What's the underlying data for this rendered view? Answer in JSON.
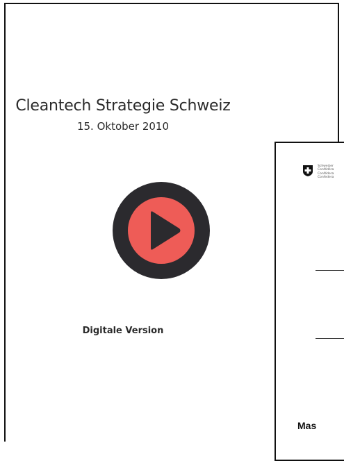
{
  "cover": {
    "title": "Cleantech Strategie Schweiz",
    "date": "15. Oktober 2010",
    "caption": "Digitale Version",
    "play_icon": "play-icon",
    "colors": {
      "play_outer": "#2b2a2e",
      "play_inner": "#ee5c57",
      "text": "#2a2a2a"
    }
  },
  "document_preview": {
    "emblem_icon": "swiss-cross-icon",
    "org_lines": [
      "Schweizer",
      "Confédéra",
      "Confédera",
      "Confedera"
    ],
    "heading": "Mas"
  }
}
